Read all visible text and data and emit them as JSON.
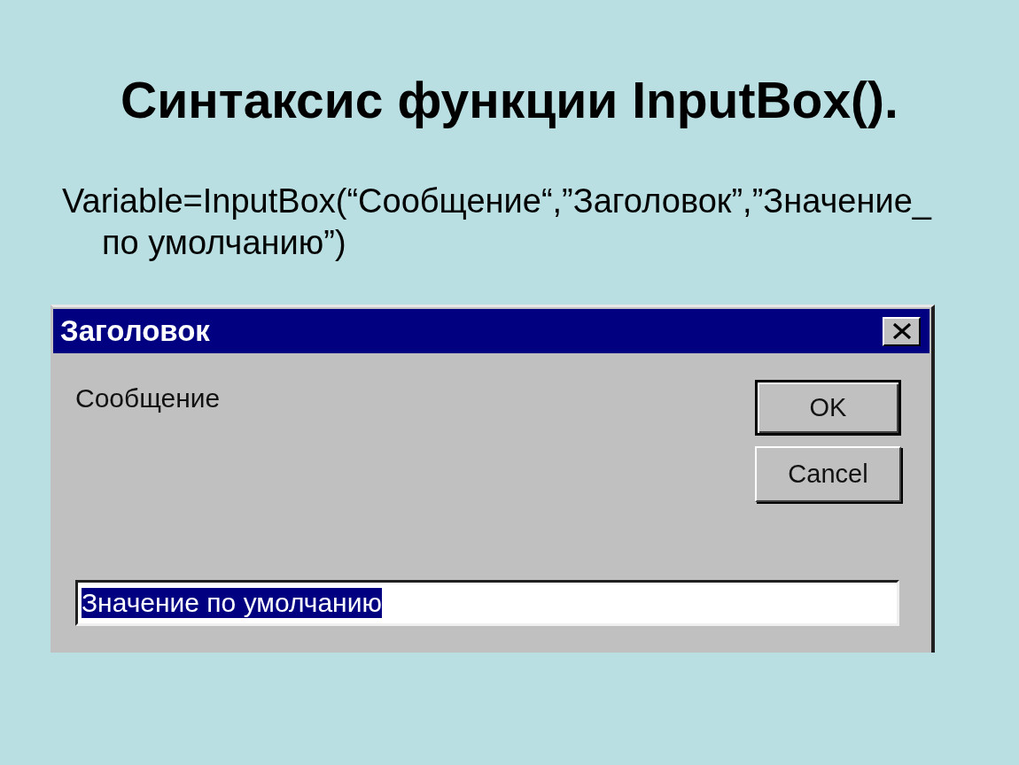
{
  "slide": {
    "title": "Синтаксис функции InputBox().",
    "syntax": "Variable=InputBox(“Сообщение“,”Заголовок”,”Значение_ по умолчанию”)"
  },
  "dialog": {
    "title": "Заголовок",
    "message": "Сообщение",
    "buttons": [
      {
        "label": "OK",
        "default": true
      },
      {
        "label": "Cancel",
        "default": false
      }
    ],
    "input": {
      "value": "Значение по умолчанию",
      "selected": true
    }
  }
}
